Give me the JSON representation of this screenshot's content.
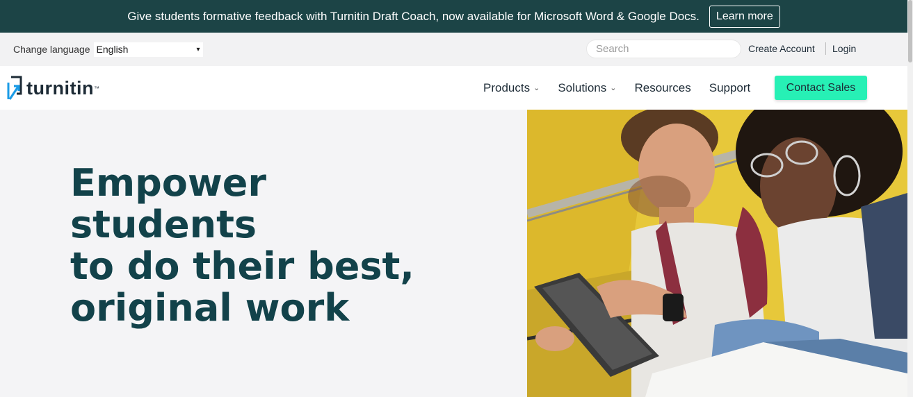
{
  "announcement": {
    "message": "Give students formative feedback with Turnitin Draft Coach, now available for Microsoft Word & Google Docs.",
    "learn_more": "Learn more"
  },
  "utility": {
    "change_language_label": "Change language",
    "language_selected": "English",
    "search_placeholder": "Search",
    "create_account": "Create Account",
    "login": "Login"
  },
  "brand": {
    "name": "turnitin",
    "tm": "™"
  },
  "nav": {
    "items": [
      {
        "label": "Products",
        "dropdown": true
      },
      {
        "label": "Solutions",
        "dropdown": true
      },
      {
        "label": "Resources",
        "dropdown": false
      },
      {
        "label": "Support",
        "dropdown": false
      }
    ],
    "cta": "Contact Sales"
  },
  "hero": {
    "headline_lines": [
      "Empower students",
      "to do their best,",
      "original work"
    ]
  },
  "colors": {
    "announcement_bg": "#1c4446",
    "cta_bg": "#27f0b5",
    "headline": "#12424a",
    "brand_blue": "#1a9be6"
  },
  "icons": {
    "language_dropdown": "chevron-down-icon",
    "nav_dropdown": "chevron-down-icon",
    "logo": "turnitin-logo-icon"
  }
}
